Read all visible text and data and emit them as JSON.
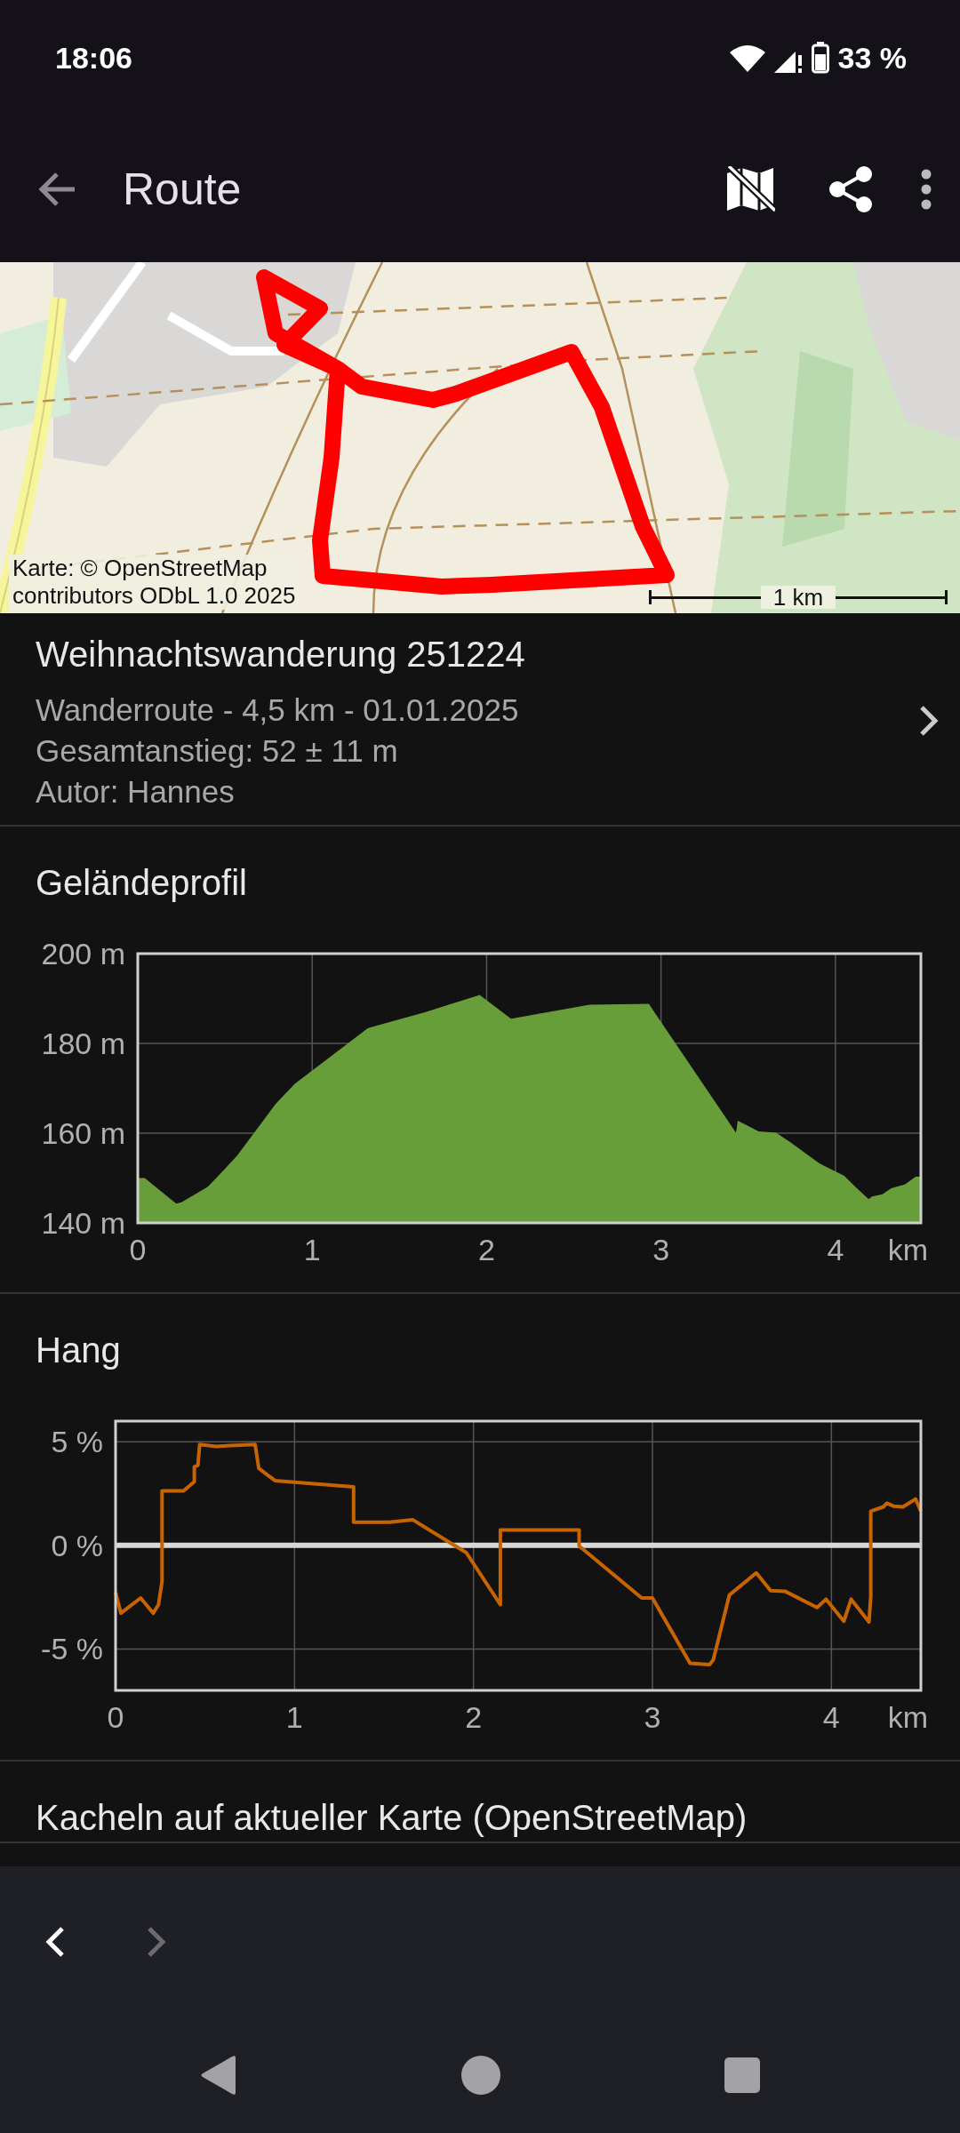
{
  "status_bar": {
    "time": "18:06",
    "battery": "33 %"
  },
  "toolbar": {
    "title": "Route"
  },
  "map": {
    "attribution": [
      "Karte: © OpenStreetMap",
      "contributors ODbL 1.0 2025"
    ],
    "scale_label": "1 km"
  },
  "route_info": {
    "title": "Weihnachtswanderung 251224",
    "lines": [
      "Wanderroute - 4,5 km - 01.01.2025",
      "Gesamtanstieg: 52 ± 11 m",
      "Autor: Hannes"
    ]
  },
  "sections": [
    {
      "title": "Geländeprofil",
      "chart_data": {
        "type": "area",
        "grid": true,
        "xlabel": "km",
        "xlim": [
          0,
          4.49
        ],
        "ylim": [
          140,
          200
        ],
        "xticks": [
          0,
          1,
          2,
          3,
          4
        ],
        "yticks": [
          {
            "value": 140,
            "label": "140 m"
          },
          {
            "value": 160,
            "label": "160 m"
          },
          {
            "value": 180,
            "label": "180 m"
          },
          {
            "value": 200,
            "label": "200 m"
          }
        ],
        "x": [
          0,
          0.04,
          0.22,
          0.25,
          0.4,
          0.45,
          0.57,
          0.79,
          0.9,
          1.32,
          1.65,
          1.96,
          2.14,
          2.59,
          2.93,
          3.43,
          3.44,
          3.56,
          3.66,
          3.74,
          3.91,
          4.05,
          4.11,
          4.19,
          4.21,
          4.27,
          4.32,
          4.4,
          4.46,
          4.49
        ],
        "series": [
          {
            "color": "#679e3a",
            "values": [
              150,
              150,
              144.3,
              144.6,
              148,
              150,
              155,
              166.5,
              171,
              183.4,
              187,
              190.8,
              185.5,
              188.6,
              188.8,
              160.1,
              162.8,
              160.4,
              160.1,
              158,
              153.2,
              150.5,
              148.2,
              145.3,
              145.9,
              146.4,
              147.7,
              148.6,
              150.3,
              150.3
            ]
          }
        ]
      }
    },
    {
      "title": "Hang",
      "chart_data": {
        "type": "line",
        "grid": true,
        "xlabel": "km",
        "xlim": [
          0,
          4.5
        ],
        "ylim": [
          -7,
          6
        ],
        "xticks": [
          0,
          1,
          2,
          3,
          4
        ],
        "yticks": [
          {
            "value": -5,
            "label": "-5 %"
          },
          {
            "value": 0,
            "label": "0 %"
          },
          {
            "value": 5,
            "label": "5 %"
          }
        ],
        "x": [
          0,
          0.03,
          0.14,
          0.21,
          0.24,
          0.26,
          0.26,
          0.38,
          0.44,
          0.44,
          0.46,
          0.47,
          0.56,
          0.78,
          0.8,
          0.89,
          1.33,
          1.33,
          1.53,
          1.66,
          1.96,
          2.15,
          2.15,
          2.59,
          2.59,
          2.94,
          3.0,
          3.21,
          3.32,
          3.34,
          3.43,
          3.58,
          3.66,
          3.74,
          3.92,
          3.97,
          4.07,
          4.11,
          4.21,
          4.22,
          4.22,
          4.29,
          4.31,
          4.35,
          4.4,
          4.47,
          4.5
        ],
        "series": [
          {
            "color": "#c86400",
            "values": [
              -2.27,
              -3.27,
              -2.54,
              -3.27,
              -2.86,
              -1.74,
              2.63,
              2.63,
              3.07,
              3.8,
              3.86,
              4.87,
              4.78,
              4.87,
              3.72,
              3.13,
              2.83,
              1.12,
              1.12,
              1.24,
              -0.35,
              -2.86,
              0.74,
              0.74,
              -0.03,
              -2.54,
              -2.54,
              -5.69,
              -5.75,
              -5.52,
              -2.39,
              -1.33,
              -2.18,
              -2.21,
              -3.0,
              -2.6,
              -3.66,
              -2.6,
              -3.69,
              -2.48,
              1.65,
              1.86,
              2.04,
              1.89,
              1.86,
              2.24,
              1.65
            ]
          }
        ]
      }
    },
    {
      "title": "Kacheln auf aktueller Karte (OpenStreetMap)"
    }
  ],
  "nav": {
    "prev": {
      "disabled": false
    },
    "next": {
      "disabled": true
    }
  }
}
